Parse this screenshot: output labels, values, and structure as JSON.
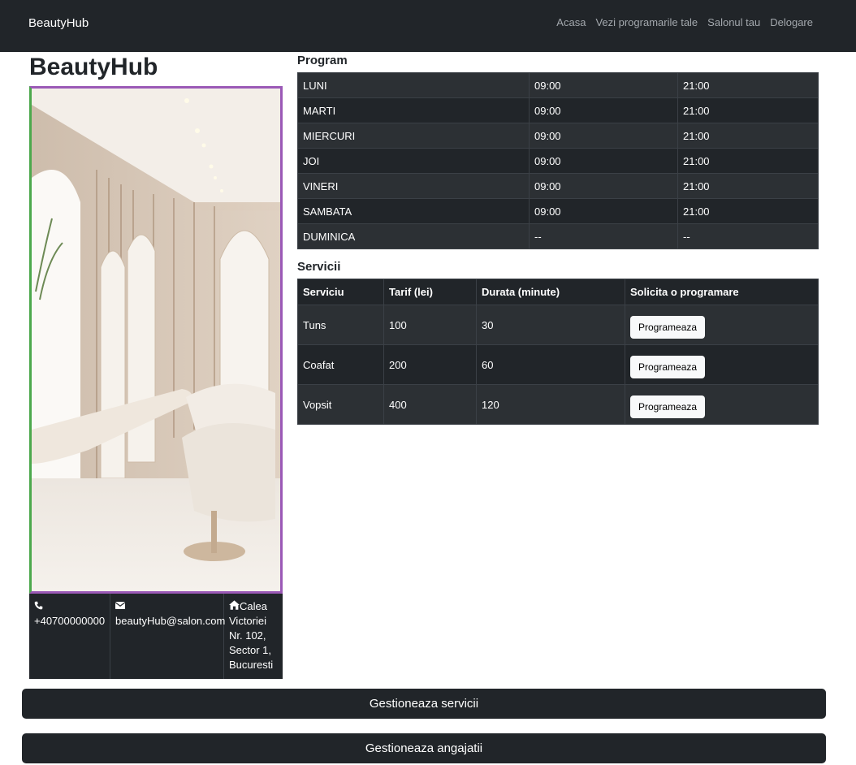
{
  "navbar": {
    "brand": "BeautyHub",
    "links": [
      "Acasa",
      "Vezi programarile tale",
      "Salonul tau",
      "Delogare"
    ]
  },
  "salon": {
    "name": "BeautyHub",
    "image_icon": "salon-interior-photo",
    "contact": {
      "phone_icon": "phone-icon",
      "phone": "+40700000000",
      "email_icon": "envelope-icon",
      "email": "beautyHub@salon.com",
      "address_icon": "house-icon",
      "address": "Calea Victoriei Nr. 102, Sector 1, Bucuresti"
    }
  },
  "schedule": {
    "title": "Program",
    "rows": [
      {
        "day": "LUNI",
        "open": "09:00",
        "close": "21:00"
      },
      {
        "day": "MARTI",
        "open": "09:00",
        "close": "21:00"
      },
      {
        "day": "MIERCURI",
        "open": "09:00",
        "close": "21:00"
      },
      {
        "day": "JOI",
        "open": "09:00",
        "close": "21:00"
      },
      {
        "day": "VINERI",
        "open": "09:00",
        "close": "21:00"
      },
      {
        "day": "SAMBATA",
        "open": "09:00",
        "close": "21:00"
      },
      {
        "day": "DUMINICA",
        "open": "--",
        "close": "--"
      }
    ]
  },
  "services": {
    "title": "Servicii",
    "headers": [
      "Serviciu",
      "Tarif (lei)",
      "Durata (minute)",
      "Solicita o programare"
    ],
    "rows": [
      {
        "name": "Tuns",
        "price": "100",
        "duration": "30",
        "action": "Programeaza"
      },
      {
        "name": "Coafat",
        "price": "200",
        "duration": "60",
        "action": "Programeaza"
      },
      {
        "name": "Vopsit",
        "price": "400",
        "duration": "120",
        "action": "Programeaza"
      }
    ]
  },
  "actions": {
    "manage_services": "Gestioneaza servicii",
    "manage_employees": "Gestioneaza angajatii"
  },
  "colors": {
    "navbar_bg": "#212529",
    "table_row_alt": "#2c3034",
    "image_border": "#9b59b6"
  }
}
